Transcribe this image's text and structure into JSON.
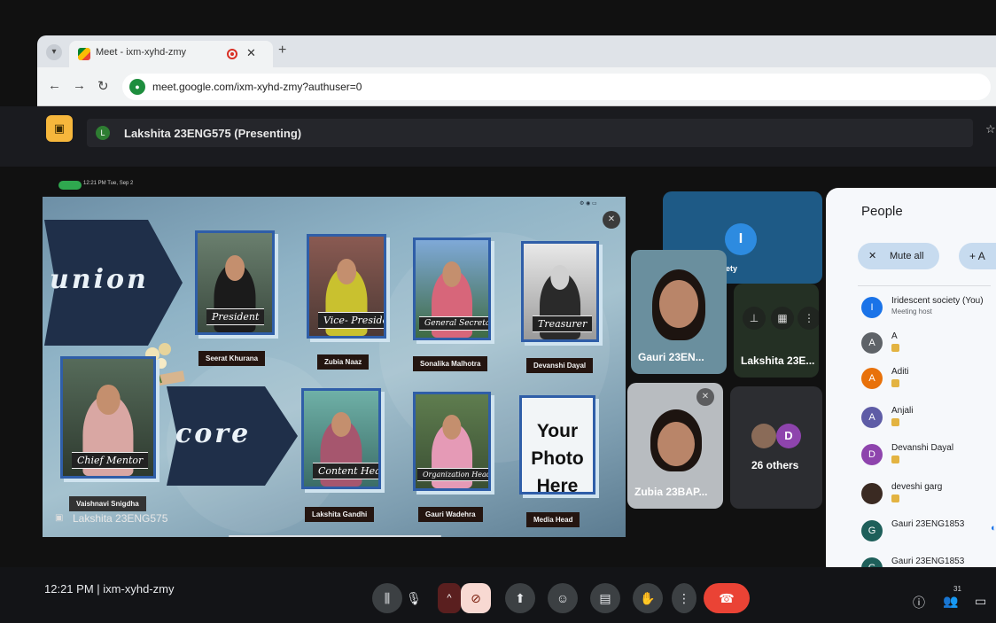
{
  "browser": {
    "tab_title": "Meet - ixm-xyhd-zmy",
    "url": "meet.google.com/ixm-xyhd-zmy?authuser=0"
  },
  "meet_header": {
    "presenter_initial": "L",
    "presenter_label": "Lakshita 23ENG575 (Presenting)"
  },
  "slide_status_time": "12:21 PM Tue, Sep 2",
  "slide": {
    "union_word": "union",
    "core_word": "core",
    "cards": [
      {
        "role": "President",
        "name": "Seerat Khurana"
      },
      {
        "role": "Vice- President",
        "name": "Zubia Naaz"
      },
      {
        "role": "General Secretary",
        "name": "Sonalika Malhotra"
      },
      {
        "role": "Treasurer",
        "name": "Devanshi Dayal"
      },
      {
        "role": "Chief Mentor",
        "name": "Vaishnavi Snigdha"
      },
      {
        "role": "Content Head",
        "name": "Lakshita Gandhi"
      },
      {
        "role": "Organization Head",
        "name": "Gauri Wadehra"
      }
    ],
    "placeholder": {
      "line1": "Your",
      "line2": "Photo",
      "line3": "Here",
      "name": "Media Head"
    },
    "presenter_tile_label": "Lakshita 23ENG575"
  },
  "tiles": {
    "iridescent": {
      "initial": "I",
      "label": "Iridescent society"
    },
    "gauri": {
      "label": "Gauri 23EN..."
    },
    "lakshita": {
      "label": "Lakshita 23E..."
    },
    "zubia": {
      "label": "Zubia 23BAP..."
    },
    "others": {
      "initial": "D",
      "label": "26 others"
    }
  },
  "people_panel": {
    "title": "People",
    "mute_all": "Mute all",
    "add_label": "A",
    "participants": [
      {
        "initial": "I",
        "name": "Iridescent society (You)",
        "sub": "Meeting host",
        "color": "#1a73e8"
      },
      {
        "initial": "A",
        "name": "A",
        "sub": "",
        "color": "#5f6368"
      },
      {
        "initial": "A",
        "name": "Aditi",
        "sub": "",
        "color": "#e8710a"
      },
      {
        "initial": "A",
        "name": "Anjali",
        "sub": "",
        "color": "#5e5ca6"
      },
      {
        "initial": "D",
        "name": "Devanshi Dayal",
        "sub": "",
        "color": "#8e44ad"
      },
      {
        "initial": "",
        "name": "deveshi garg",
        "sub": "",
        "color": "#3a2a22"
      },
      {
        "initial": "G",
        "name": "Gauri 23ENG1853",
        "sub": "",
        "color": "#1e5f5a"
      },
      {
        "initial": "G",
        "name": "Gauri 23ENG1853",
        "sub": "",
        "color": "#1e5f5a"
      }
    ]
  },
  "bottom": {
    "time": "12:21 PM",
    "separator": "|",
    "meeting_code": "ixm-xyhd-zmy",
    "people_count": "31"
  },
  "colors": {
    "end_call": "#ea4335",
    "accent_blue": "#1a73e8",
    "slide_card_border": "#2f5ea8"
  }
}
